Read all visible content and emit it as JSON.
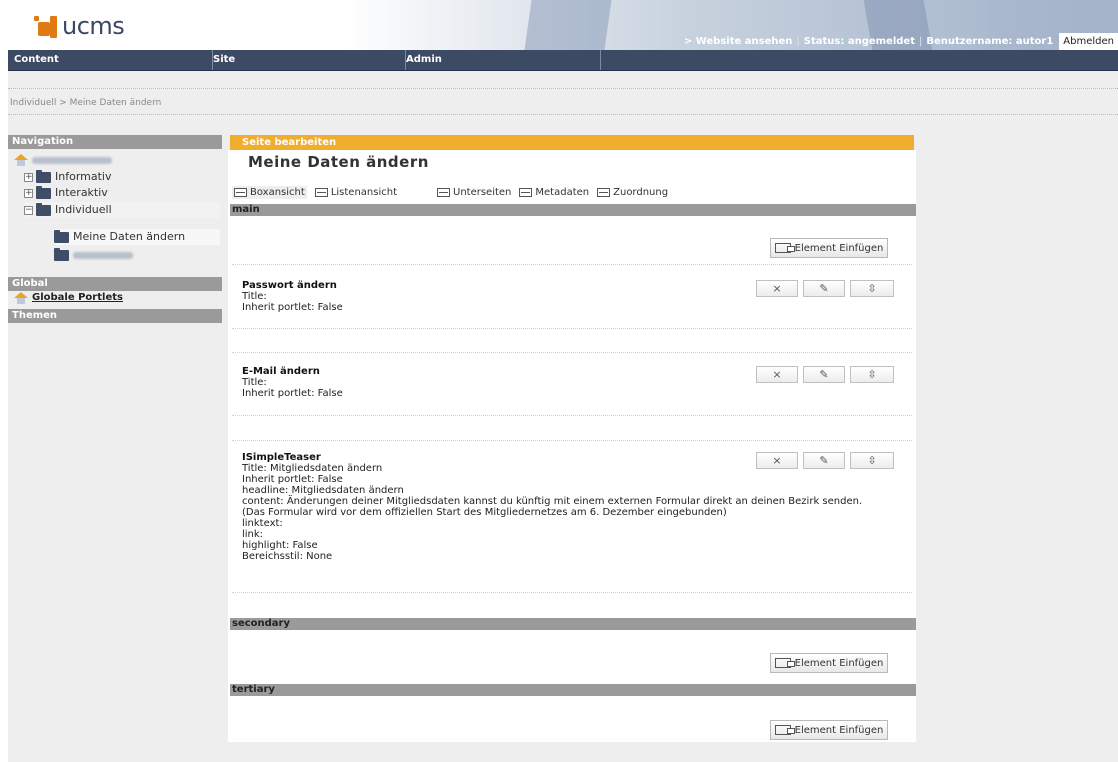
{
  "header": {
    "logo_text": "ucms",
    "links": [
      "> Website ansehen",
      "Status: angemeldet",
      "Benutzername: autor1"
    ],
    "separator": "|",
    "logout_label": "Abmelden"
  },
  "menu": {
    "items": [
      "Content",
      "Site",
      "Admin"
    ]
  },
  "breadcrumb": "Individuell > Meine Daten ändern",
  "sidebar": {
    "navigation_title": "Navigation",
    "tree": {
      "informativ": "Informativ",
      "interaktiv": "Interaktiv",
      "individuell": "Individuell",
      "meine_daten": "Meine Daten ändern"
    },
    "global_title": "Global",
    "global_portlets": "Globale Portlets",
    "themen_title": "Themen"
  },
  "editor": {
    "bar_label": "Seite bearbeiten",
    "page_title": "Meine Daten ändern",
    "tabs": [
      "Boxansicht",
      "Listenansicht",
      "Unterseiten",
      "Metadaten",
      "Zuordnung"
    ]
  },
  "sections": {
    "main": "main",
    "secondary": "secondary",
    "tertiary": "tertiary",
    "insert_label": "Element Einfügen"
  },
  "portlets": [
    {
      "title": "Passwort ändern",
      "lines": [
        "Title:",
        "Inherit portlet: False"
      ]
    },
    {
      "title": "E-Mail ändern",
      "lines": [
        "Title:",
        "Inherit portlet: False"
      ]
    },
    {
      "title": "ISimpleTeaser",
      "lines": [
        "Title: Mitgliedsdaten ändern",
        "Inherit portlet: False",
        "headline: Mitgliedsdaten ändern",
        "content: Änderungen deiner Mitgliedsdaten kannst du künftig mit einem externen Formular direkt an deinen Bezirk senden.",
        "(Das Formular wird vor dem offiziellen Start des Mitgliedernetzes am 6. Dezember eingebunden)",
        "linktext:",
        "link:",
        "highlight: False",
        "Bereichsstil: None"
      ]
    }
  ],
  "colors": {
    "menu_bg": "#3d4a63",
    "accent_orange": "#f0ad2e",
    "logo_orange": "#e07a12",
    "section_gray": "#9a9a9a"
  }
}
